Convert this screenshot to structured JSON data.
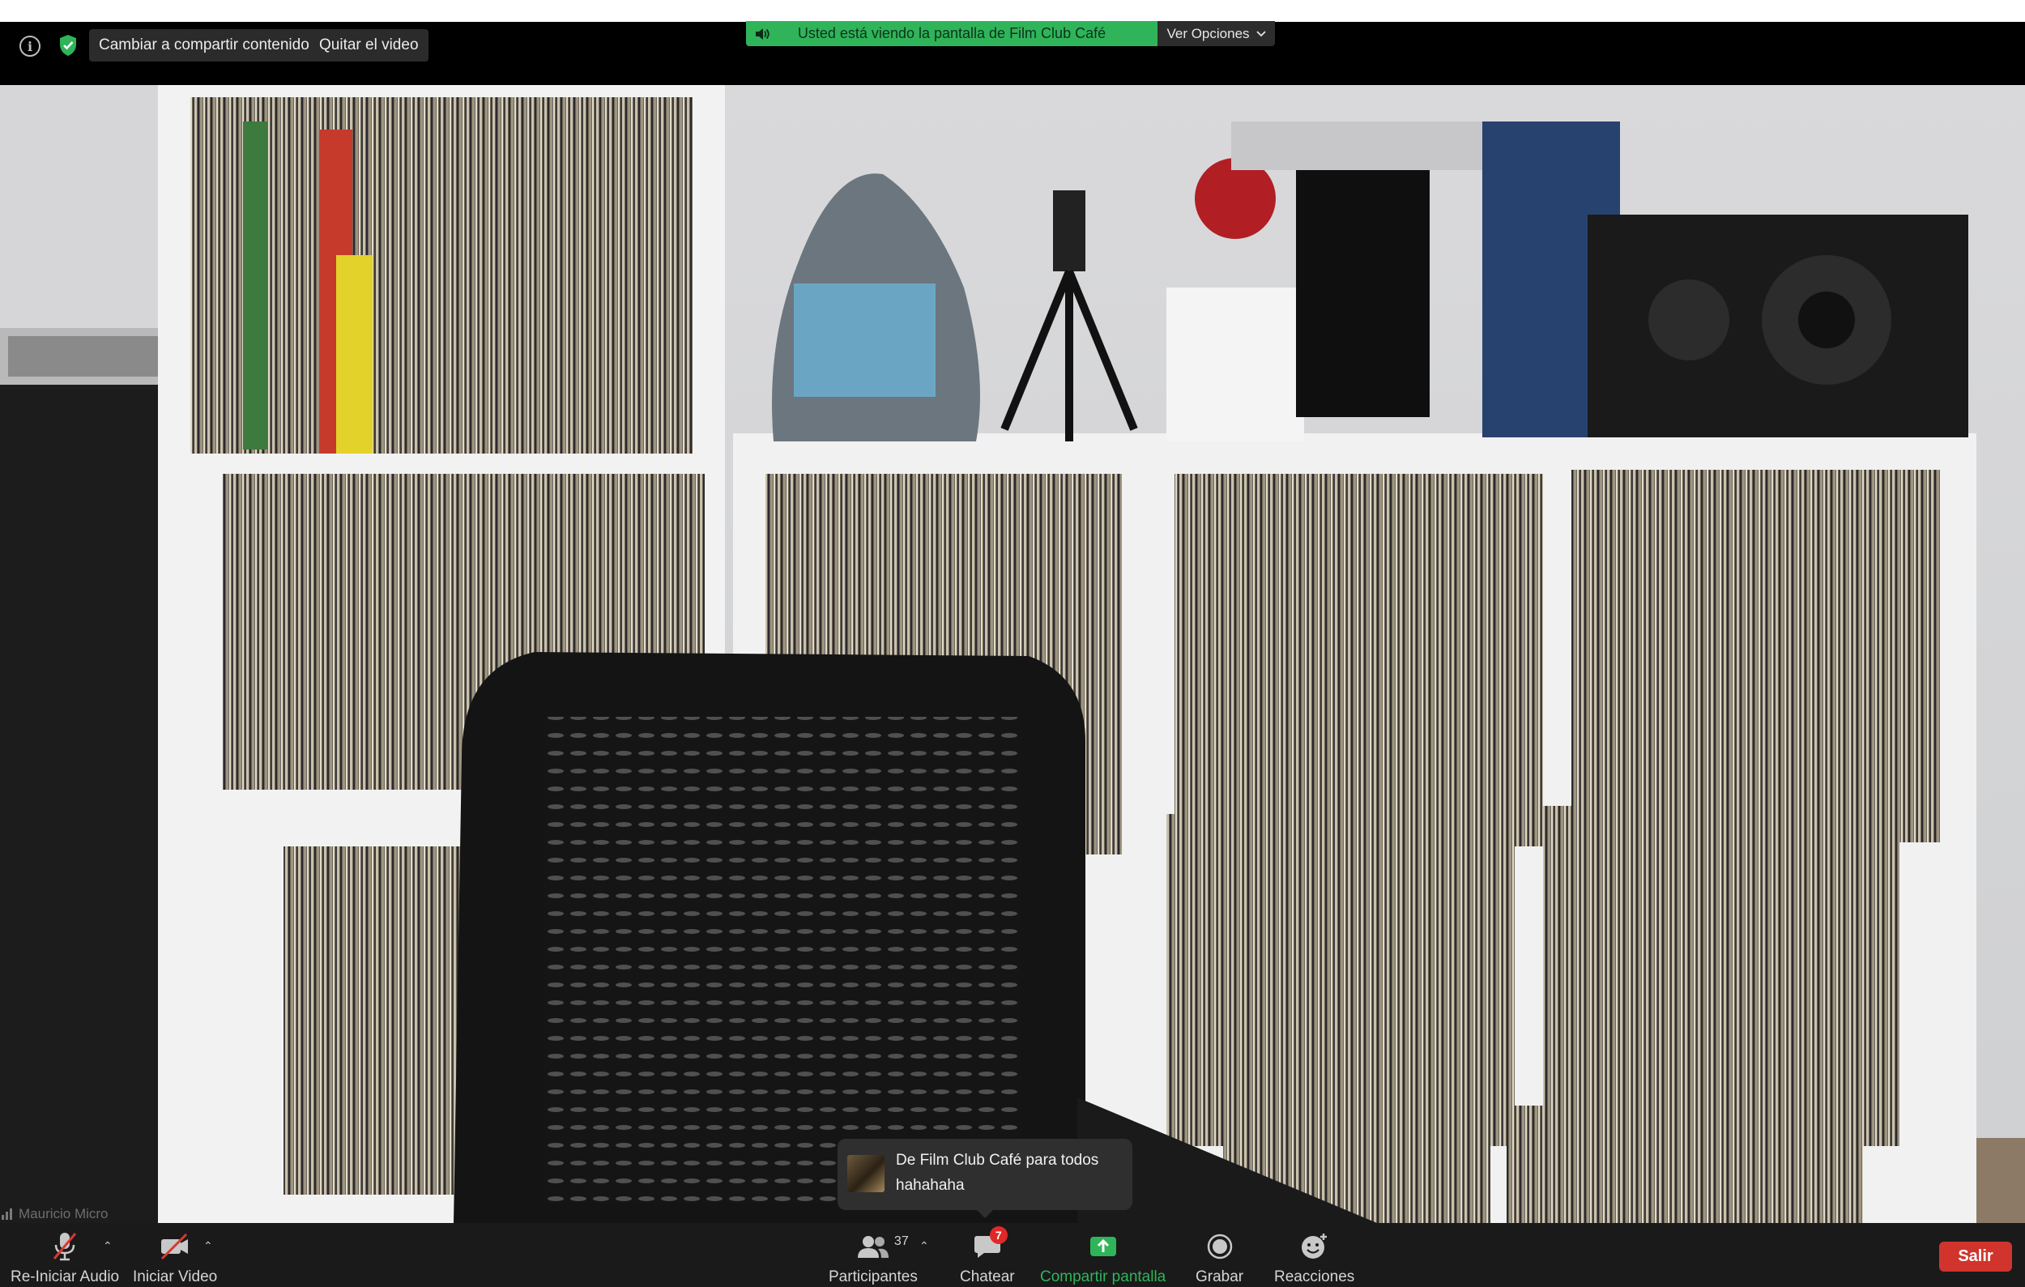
{
  "banner": {
    "text": "Usted está viendo la pantalla de Film Club Café",
    "options_label": "Ver Opciones",
    "color": "#2fb45a"
  },
  "top_controls": {
    "info_icon": "info-icon",
    "shield_icon": "shield-check-icon",
    "switch_label": "Cambiar a compartir contenido",
    "remove_video_label": "Quitar el video"
  },
  "video": {
    "speaker_name": "Mauricio Micro"
  },
  "chat_popup": {
    "from": "De Film Club Café para todos",
    "message": "hahahaha"
  },
  "toolbar": {
    "audio_label": "Re-Iniciar Audio",
    "video_label": "Iniciar Video",
    "participants_label": "Participantes",
    "participants_count": "37",
    "chat_label": "Chatear",
    "chat_badge": "7",
    "share_label": "Compartir pantalla",
    "record_label": "Grabar",
    "reactions_label": "Reacciones",
    "leave_label": "Salir",
    "share_color": "#2fb45a",
    "leave_color": "#d0342c"
  }
}
